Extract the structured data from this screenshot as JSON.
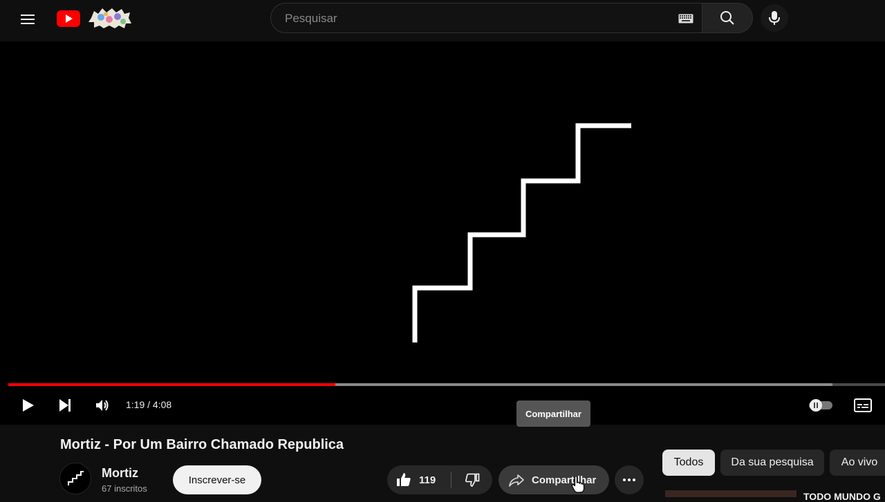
{
  "header": {
    "search_placeholder": "Pesquisar"
  },
  "player": {
    "current_time": "1:19",
    "duration": "4:08",
    "time_display": "1:19 / 4:08",
    "progress_fraction": 0.373,
    "buffered_fraction": 0.94,
    "tooltip": "Compartilhar"
  },
  "video": {
    "title": "Mortiz - Por Um Bairro Chamado Republica",
    "channel_name": "Mortiz",
    "subscribers": "67 inscritos",
    "subscribe_label": "Inscrever-se",
    "likes": "119",
    "share_label": "Compartilhar"
  },
  "chips": [
    "Todos",
    "Da sua pesquisa",
    "Ao vivo"
  ],
  "suggestion": {
    "title_fragment": "TODO MUNDO G"
  },
  "colors": {
    "accent": "#ff0000",
    "background": "#0f0f0f"
  }
}
